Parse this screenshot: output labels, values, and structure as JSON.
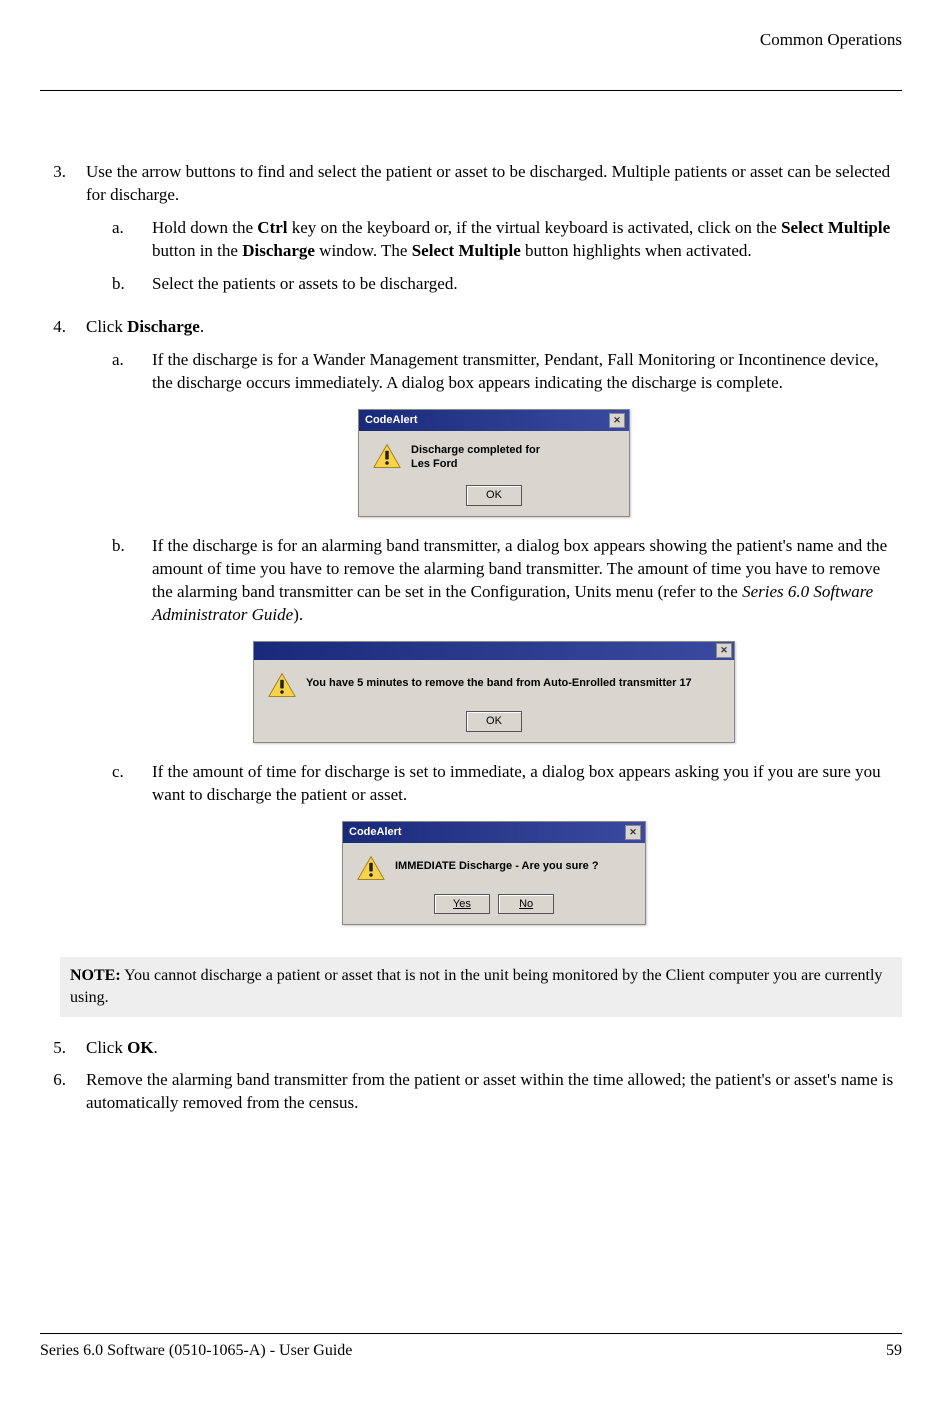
{
  "header": {
    "section": "Common Operations"
  },
  "steps": {
    "s3": {
      "num": "3.",
      "text_a": "Use the arrow buttons to find and select the patient or asset to be discharged. Multiple patients or asset can be selected for discharge.",
      "a": {
        "letter": "a.",
        "pre": "Hold down the ",
        "b1": "Ctrl",
        "mid1": " key on the keyboard or, if the virtual keyboard is activated, click on the ",
        "b2": "Select Multiple",
        "mid2": " button in the ",
        "b3": "Discharge",
        "mid3": " window. The ",
        "b4": "Select Multiple",
        "post": " button highlights when activated."
      },
      "b": {
        "letter": "b.",
        "text": "Select the patients or assets to be discharged."
      }
    },
    "s4": {
      "num": "4.",
      "pre": "Click ",
      "b1": "Discharge",
      "post": ".",
      "a": {
        "letter": "a.",
        "text": "If the discharge is for a Wander Management transmitter, Pendant, Fall Monitoring or Incontinence device, the discharge occurs immediately. A dialog box appears indicating the discharge is complete."
      },
      "b": {
        "letter": "b.",
        "pre": "If the discharge is for an alarming band transmitter, a dialog box appears showing the patient's name and the amount of time you have to remove the alarming band transmitter. The amount of time you have to remove the alarming band transmitter can be set in the Configuration, Units menu (refer to the ",
        "italic": "Series 6.0 Software Administrator Guide",
        "post": ")."
      },
      "c": {
        "letter": "c.",
        "text": "If the amount of time for discharge is set to immediate, a dialog box appears asking you if you are sure you want to discharge the patient or asset."
      }
    },
    "s5": {
      "num": "5.",
      "pre": "Click ",
      "b1": "OK",
      "post": "."
    },
    "s6": {
      "num": "6.",
      "text": "Remove the alarming band transmitter from the patient or asset within the time allowed; the patient's or asset's name is automatically removed from the census."
    }
  },
  "dialogs": {
    "d1": {
      "title": "CodeAlert",
      "msg_line1": "Discharge completed for",
      "msg_line2": "Les Ford",
      "ok": "OK"
    },
    "d2": {
      "msg": "You have 5 minutes to remove the band from Auto-Enrolled transmitter 17",
      "ok": "OK"
    },
    "d3": {
      "title": "CodeAlert",
      "msg": "IMMEDIATE Discharge - Are you sure ?",
      "yes": "Yes",
      "no": "No"
    }
  },
  "note": {
    "label": "NOTE:",
    "text": " You cannot discharge a patient or asset that is not in the unit being monitored by the Client computer you are currently using."
  },
  "footer": {
    "left": "Series 6.0 Software (0510-1065-A) - User Guide",
    "right": "59"
  }
}
